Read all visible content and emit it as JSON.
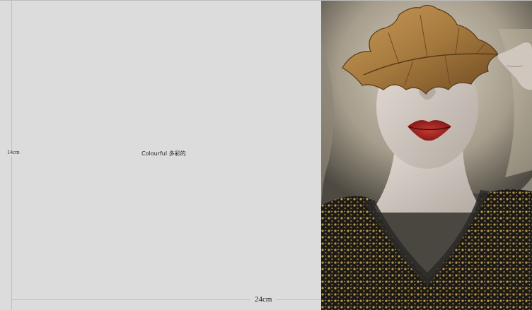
{
  "page": {
    "height_label": "14cm",
    "width_label": "24cm",
    "caption": "Colourful 多彩的"
  },
  "colors": {
    "canvas": "#dcdcdc",
    "guide": "#bfbfbf",
    "lip": "#a51c1c",
    "leaf": "#a67a3e"
  }
}
